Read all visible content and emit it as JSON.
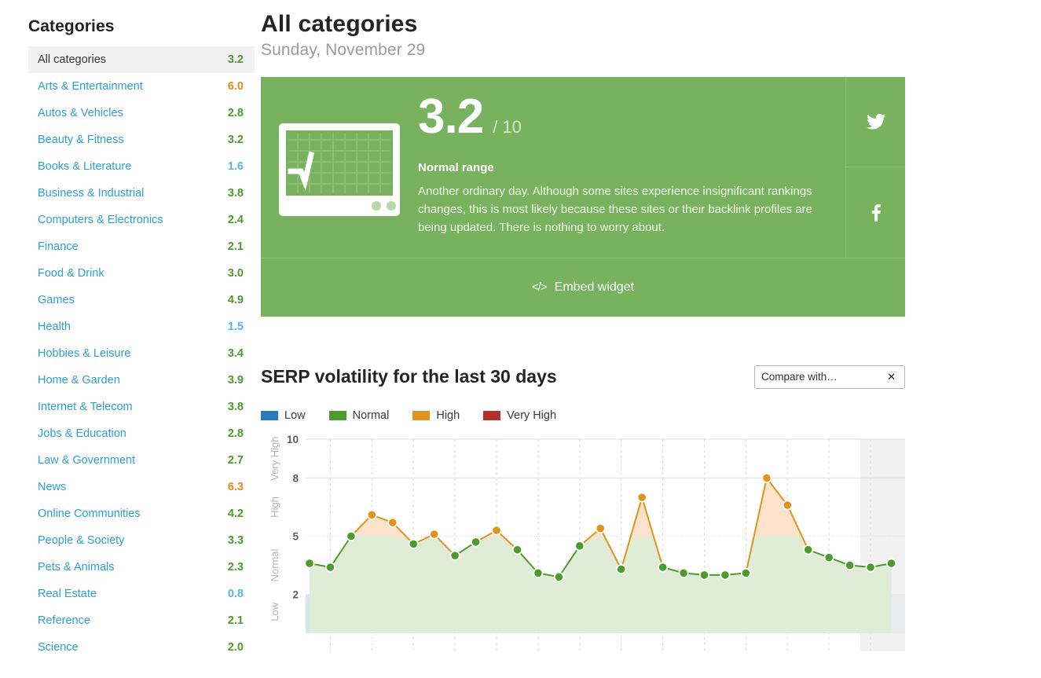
{
  "sidebar": {
    "title": "Categories",
    "items": [
      {
        "label": "All categories",
        "score": "3.2",
        "tone": "green",
        "active": true
      },
      {
        "label": "Arts & Entertainment",
        "score": "6.0",
        "tone": "orange",
        "active": false
      },
      {
        "label": "Autos & Vehicles",
        "score": "2.8",
        "tone": "green",
        "active": false
      },
      {
        "label": "Beauty & Fitness",
        "score": "3.2",
        "tone": "green",
        "active": false
      },
      {
        "label": "Books & Literature",
        "score": "1.6",
        "tone": "blue",
        "active": false
      },
      {
        "label": "Business & Industrial",
        "score": "3.8",
        "tone": "green",
        "active": false
      },
      {
        "label": "Computers & Electronics",
        "score": "2.4",
        "tone": "green",
        "active": false
      },
      {
        "label": "Finance",
        "score": "2.1",
        "tone": "green",
        "active": false
      },
      {
        "label": "Food & Drink",
        "score": "3.0",
        "tone": "green",
        "active": false
      },
      {
        "label": "Games",
        "score": "4.9",
        "tone": "green",
        "active": false
      },
      {
        "label": "Health",
        "score": "1.5",
        "tone": "blue",
        "active": false
      },
      {
        "label": "Hobbies & Leisure",
        "score": "3.4",
        "tone": "green",
        "active": false
      },
      {
        "label": "Home & Garden",
        "score": "3.9",
        "tone": "green",
        "active": false
      },
      {
        "label": "Internet & Telecom",
        "score": "3.8",
        "tone": "green",
        "active": false
      },
      {
        "label": "Jobs & Education",
        "score": "2.8",
        "tone": "green",
        "active": false
      },
      {
        "label": "Law & Government",
        "score": "2.7",
        "tone": "green",
        "active": false
      },
      {
        "label": "News",
        "score": "6.3",
        "tone": "orange",
        "active": false
      },
      {
        "label": "Online Communities",
        "score": "4.2",
        "tone": "green",
        "active": false
      },
      {
        "label": "People & Society",
        "score": "3.3",
        "tone": "green",
        "active": false
      },
      {
        "label": "Pets & Animals",
        "score": "2.3",
        "tone": "green",
        "active": false
      },
      {
        "label": "Real Estate",
        "score": "0.8",
        "tone": "blue",
        "active": false
      },
      {
        "label": "Reference",
        "score": "2.1",
        "tone": "green",
        "active": false
      },
      {
        "label": "Science",
        "score": "2.0",
        "tone": "green",
        "active": false
      }
    ]
  },
  "header": {
    "title": "All categories",
    "date": "Sunday, November 29"
  },
  "score_card": {
    "icon": "monitor-chart-icon",
    "value": "3.2",
    "out_of": "/ 10",
    "range_label": "Normal range",
    "description": "Another ordinary day. Although some sites experience insignificant rankings changes, this is most likely because these sites or their backlink profiles are being updated. There is nothing to worry about.",
    "background_color": "#79b25e",
    "share": [
      {
        "icon": "twitter-icon",
        "name": "share-twitter"
      },
      {
        "icon": "facebook-icon",
        "name": "share-facebook"
      }
    ],
    "embed": {
      "icon": "code-icon",
      "label": "Embed widget"
    }
  },
  "chart_section": {
    "title": "SERP volatility for the last 30 days",
    "compare": {
      "selected": "Compare with…",
      "options": [
        "Compare with…"
      ]
    }
  },
  "chart_data": {
    "type": "line",
    "title": "SERP volatility for the last 30 days",
    "xlabel": "",
    "ylabel": "",
    "ylim": [
      0,
      10
    ],
    "yticks": [
      10,
      8,
      5,
      2
    ],
    "grid": true,
    "legend_position": "top-left",
    "legend": [
      {
        "name": "Low",
        "color": "#2b7bba"
      },
      {
        "name": "Normal",
        "color": "#4d9a2e"
      },
      {
        "name": "High",
        "color": "#e0931f"
      },
      {
        "name": "Very High",
        "color": "#b5302a"
      }
    ],
    "bands": [
      {
        "name": "Low",
        "range": [
          0,
          2
        ],
        "color": "#d6e6f2"
      },
      {
        "name": "Normal",
        "range": [
          2,
          5
        ],
        "color": "#dfecd6"
      },
      {
        "name": "High",
        "range": [
          5,
          8
        ],
        "color": "#fae4cd"
      },
      {
        "name": "Very High",
        "range": [
          8,
          10
        ],
        "color": "#f2d5d3"
      }
    ],
    "series": [
      {
        "name": "SERP volatility",
        "values": [
          3.6,
          3.4,
          5.0,
          6.1,
          5.7,
          4.6,
          5.1,
          4.0,
          4.7,
          5.3,
          4.3,
          3.1,
          2.9,
          4.5,
          5.4,
          3.3,
          7.0,
          3.4,
          3.1,
          3.0,
          3.0,
          3.1,
          8.0,
          6.6,
          4.3,
          3.9,
          3.5,
          3.4,
          3.6
        ],
        "point_colors": [
          "normal",
          "normal",
          "normal",
          "high",
          "high",
          "normal",
          "high",
          "normal",
          "normal",
          "high",
          "normal",
          "normal",
          "normal",
          "normal",
          "high",
          "normal",
          "high",
          "normal",
          "normal",
          "normal",
          "normal",
          "normal",
          "high",
          "high",
          "normal",
          "normal",
          "normal",
          "normal",
          "normal"
        ]
      }
    ],
    "highlight_last_column": true
  }
}
